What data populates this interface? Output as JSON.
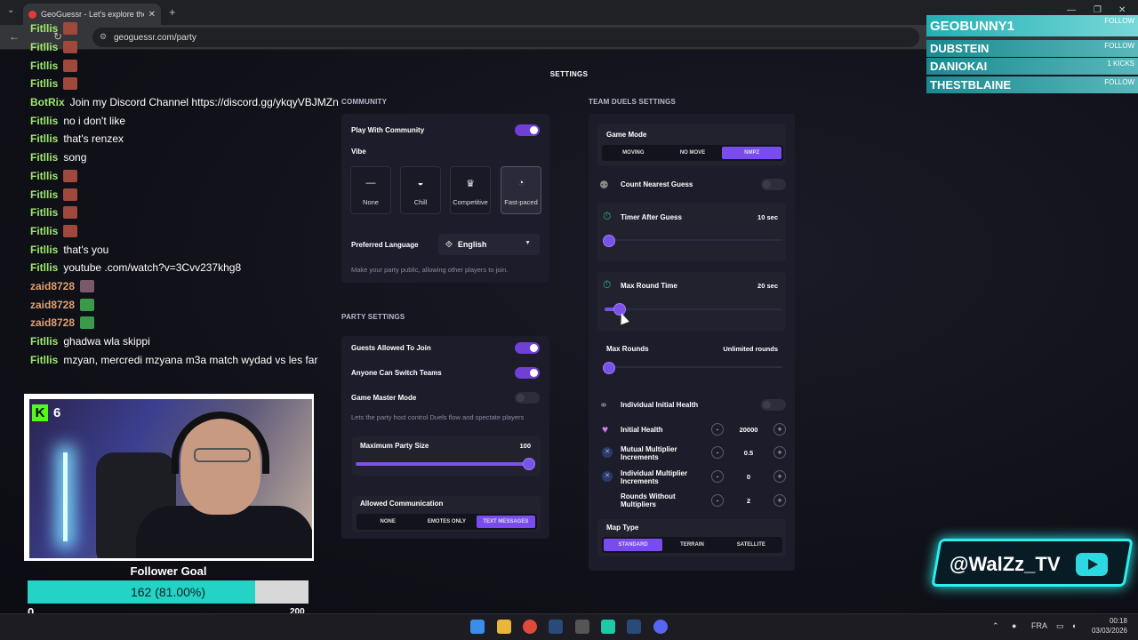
{
  "browser": {
    "tab_title": "GeoGuessr - Let's explore the w",
    "tab_close": "✕",
    "new_tab": "+",
    "url": "geoguessr.com/party"
  },
  "page": {
    "title": "SETTINGS",
    "community": {
      "header": "COMMUNITY",
      "play_with_community": "Play With Community",
      "play_with_community_on": true,
      "vibe_label": "Vibe",
      "vibes": [
        {
          "label": "None",
          "icon": "dash-icon"
        },
        {
          "label": "Chill",
          "icon": "sunglasses-icon"
        },
        {
          "label": "Competitive",
          "icon": "crown-icon"
        },
        {
          "label": "Fast-paced",
          "icon": "speedometer-icon",
          "selected": true
        }
      ],
      "preferred_language_label": "Preferred Language",
      "preferred_language_value": "English",
      "description": "Make your party public, allowing other players to join."
    },
    "party": {
      "header": "PARTY SETTINGS",
      "guests_allowed": "Guests Allowed To Join",
      "anyone_switch": "Anyone Can Switch Teams",
      "game_master": "Game Master Mode",
      "game_master_desc": "Lets the party host control Duels flow and spectate players",
      "max_party_size_label": "Maximum Party Size",
      "max_party_size_value": "100",
      "max_party_size_fraction": 1.0,
      "allowed_comm_label": "Allowed Communication",
      "comm_options": [
        "NONE",
        "EMOTES ONLY",
        "TEXT MESSAGES"
      ],
      "comm_selected": 2
    },
    "team_duels": {
      "header": "TEAM DUELS SETTINGS",
      "game_mode_label": "Game Mode",
      "modes": [
        "MOVING",
        "NO MOVE",
        "NMPZ"
      ],
      "mode_selected": 2,
      "count_nearest": "Count Nearest Guess",
      "timer_after_guess_label": "Timer After Guess",
      "timer_after_guess_value": "10 sec",
      "max_round_time_label": "Max Round Time",
      "max_round_time_value": "20 sec",
      "max_rounds_label": "Max Rounds",
      "max_rounds_value": "Unlimited rounds",
      "individual_initial_health": "Individual Initial Health",
      "initial_health_label": "Initial Health",
      "initial_health_value": "20000",
      "mutual_mult_label": "Mutual Multiplier Increments",
      "mutual_mult_value": "0.5",
      "indiv_mult_label": "Individual Multiplier Increments",
      "indiv_mult_value": "0",
      "rounds_without_label": "Rounds Without Multipliers",
      "rounds_without_value": "2",
      "minus": "-",
      "plus": "+",
      "map_type_label": "Map Type",
      "map_types": [
        "STANDARD",
        "TERRAIN",
        "SATELLITE"
      ],
      "map_selected": 0
    }
  },
  "chat": [
    {
      "user": "Fitllis",
      "color": "#9ee86b",
      "text": "",
      "emote": "r"
    },
    {
      "user": "Fitllis",
      "color": "#9ee86b",
      "text": "",
      "emote": "r"
    },
    {
      "user": "Fitllis",
      "color": "#9ee86b",
      "text": "",
      "emote": "r"
    },
    {
      "user": "Fitllis",
      "color": "#9ee86b",
      "text": "",
      "emote": "r"
    },
    {
      "user": "BotRix",
      "color": "#9ee86b",
      "text": "Join my Discord Channel https://discord.gg/ykqyVBJMZn",
      "emote": ""
    },
    {
      "user": "Fitllis",
      "color": "#9ee86b",
      "text": "no i don't like",
      "emote": ""
    },
    {
      "user": "Fitllis",
      "color": "#9ee86b",
      "text": "that's renzex",
      "emote": ""
    },
    {
      "user": "Fitllis",
      "color": "#9ee86b",
      "text": "song",
      "emote": ""
    },
    {
      "user": "Fitllis",
      "color": "#9ee86b",
      "text": "",
      "emote": "r"
    },
    {
      "user": "Fitllis",
      "color": "#9ee86b",
      "text": "",
      "emote": "r"
    },
    {
      "user": "Fitllis",
      "color": "#9ee86b",
      "text": "",
      "emote": "r"
    },
    {
      "user": "Fitllis",
      "color": "#9ee86b",
      "text": "",
      "emote": "r"
    },
    {
      "user": "Fitllis",
      "color": "#9ee86b",
      "text": "that's you",
      "emote": ""
    },
    {
      "user": "Fitllis",
      "color": "#9ee86b",
      "text": "youtube .com/watch?v=3Cvv237khg8",
      "emote": ""
    },
    {
      "user": "zaid8728",
      "color": "#e0a070",
      "text": "",
      "emote": "p"
    },
    {
      "user": "zaid8728",
      "color": "#e0a070",
      "text": "",
      "emote": "g"
    },
    {
      "user": "zaid8728",
      "color": "#e0a070",
      "text": "",
      "emote": "g"
    },
    {
      "user": "Fitllis",
      "color": "#9ee86b",
      "text": "ghadwa wla skippi",
      "emote": ""
    },
    {
      "user": "Fitllis",
      "color": "#9ee86b",
      "text": "mzyan, mercredi mzyana m3a match wydad vs les far",
      "emote": ""
    }
  ],
  "stream": {
    "kick_viewers": "6",
    "follower_goal_title": "Follower Goal",
    "follower_goal_text": "162 (81.00%)",
    "follower_goal_fraction": 0.81,
    "goal_min": "0",
    "goal_max": "200",
    "followers": [
      {
        "name": "GEOBUNNY1",
        "tag": "FOLLOW"
      },
      {
        "name": "DUBSTEIN",
        "tag": "FOLLOW"
      },
      {
        "name": "DANIOKAI",
        "tag": "1 KICKS"
      },
      {
        "name": "THESTBLAINE",
        "tag": "FOLLOW"
      }
    ],
    "channel_handle": "@WalZz_TV"
  },
  "taskbar": {
    "lang": "FRA",
    "time": "00:18",
    "date": "03/03/2026"
  },
  "colors": {
    "accent": "#7a4cf0",
    "chat_user": "#9ee86b",
    "goal_fill": "#22d3c6"
  }
}
